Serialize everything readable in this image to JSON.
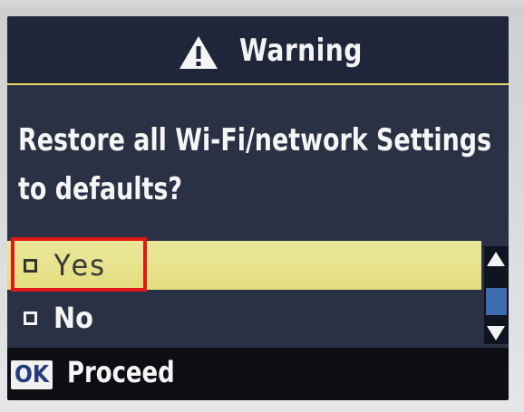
{
  "dialog": {
    "title": "Warning",
    "message_line1": "Restore all Wi-Fi/network Settings",
    "message_line2": "to defaults?"
  },
  "options": [
    {
      "label": "Yes",
      "selected": true
    },
    {
      "label": "No",
      "selected": false
    }
  ],
  "footer": {
    "ok_key": "OK",
    "action_label": "Proceed"
  },
  "colors": {
    "screen_bg": "#2a3144",
    "selected_row": "#e8e38e",
    "highlight_box": "#e01818",
    "scroll_thumb": "#3c6bb0"
  },
  "icons": {
    "title_icon": "warning-icon",
    "scroll_up": "arrow-up-icon",
    "scroll_down": "arrow-down-icon"
  }
}
